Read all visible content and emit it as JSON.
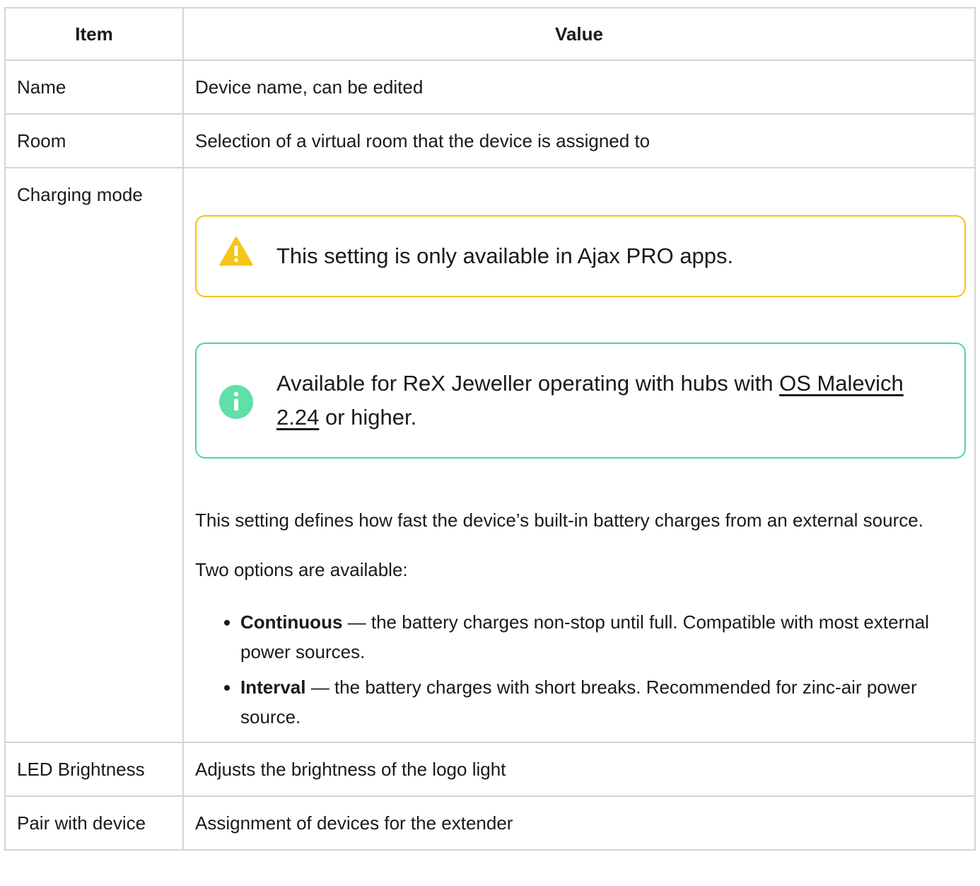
{
  "header": {
    "item": "Item",
    "value": "Value"
  },
  "rows": {
    "name": {
      "item": "Name",
      "value": "Device name, can be edited"
    },
    "room": {
      "item": "Room",
      "value": "Selection of a virtual room that the device is assigned to"
    },
    "charging": {
      "item": "Charging mode",
      "warning": "This setting is only available in Ajax PRO apps.",
      "info_prefix": "Available for ReX Jeweller operating with hubs with ",
      "info_link": "OS Malevich 2.24",
      "info_suffix": " or higher.",
      "description": "This setting defines how fast the device’s built-in battery charges from an external source.",
      "options_intro": "Two options are available:",
      "options": [
        {
          "name": "Continuous",
          "text": " — the battery charges non-stop until full. Compatible with most external power sources."
        },
        {
          "name": "Interval",
          "text": " — the battery charges with short breaks. Recommended for zinc-air power source."
        }
      ]
    },
    "led": {
      "item": "LED Brightness",
      "value": "Adjusts the brightness of the logo light"
    },
    "pair": {
      "item": "Pair with device",
      "value": "Assignment of devices for the extender"
    }
  },
  "colors": {
    "warning_border": "#f1c40f",
    "warning_icon": "#f5c518",
    "info_border": "#4fd6a0",
    "info_icon": "#5ee0a8",
    "grid": "#d4d4d4"
  },
  "icons": {
    "warning": "warning-triangle-icon",
    "info": "info-circle-icon"
  }
}
